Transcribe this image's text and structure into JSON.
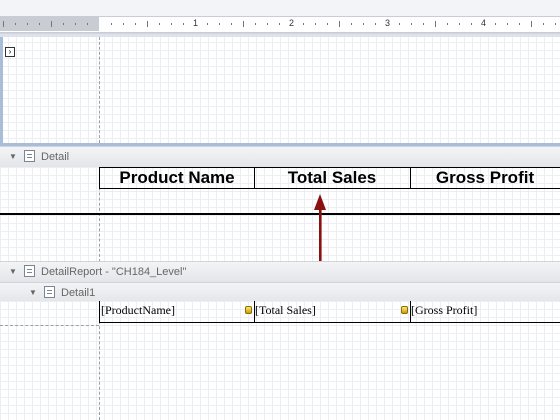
{
  "ruler": {
    "numbers": [
      "1",
      "2",
      "3",
      "4"
    ]
  },
  "bands": {
    "detail": {
      "label": "Detail"
    },
    "detail_report": {
      "label": "DetailReport - \"CH184_Level\""
    },
    "detail1": {
      "label": "Detail1"
    }
  },
  "header_cells": [
    "Product Name",
    "Total Sales",
    "Gross Profit"
  ],
  "fields": [
    "[ProductName]",
    "[Total Sales]",
    "[Gross Profit]"
  ],
  "colors": {
    "arrow": "#8b1010",
    "band_accent": "#a9bdd8"
  }
}
